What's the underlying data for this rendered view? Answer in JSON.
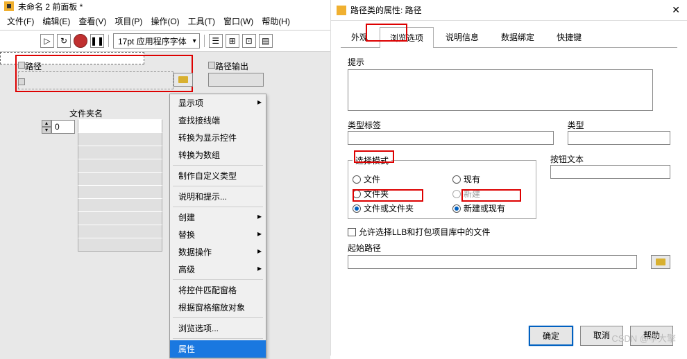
{
  "window": {
    "title": "未命名 2 前面板 *",
    "menus": [
      "文件(F)",
      "编辑(E)",
      "查看(V)",
      "项目(P)",
      "操作(O)",
      "工具(T)",
      "窗口(W)",
      "帮助(H)"
    ],
    "dialog_title": "路径类的属性: 路径"
  },
  "toolbar": {
    "font": "17pt 应用程序字体"
  },
  "canvas": {
    "path_label": "路径",
    "path_out_label": "路径输出",
    "folder_name_label": "文件夹名",
    "array_index": "0"
  },
  "context_menu": {
    "items": [
      "显示项",
      "查找接线端",
      "转换为显示控件",
      "转换为数组"
    ],
    "items2": [
      "制作自定义类型"
    ],
    "items3": [
      "说明和提示..."
    ],
    "items4": [
      "创建",
      "替换",
      "数据操作",
      "高级"
    ],
    "items5": [
      "将控件匹配窗格",
      "根据窗格缩放对象"
    ],
    "items6": [
      "浏览选项..."
    ],
    "items7": [
      "属性"
    ]
  },
  "props": {
    "tabs": [
      "外观",
      "浏览选项",
      "说明信息",
      "数据绑定",
      "快捷键"
    ],
    "hint_label": "提示",
    "type_tag_label": "类型标签",
    "type_label": "类型",
    "mode_label": "选择模式",
    "radio1": "文件",
    "radio2": "现有",
    "radio3": "文件夹",
    "radio4": "新建",
    "radio5": "文件或文件夹",
    "radio6": "新建或现有",
    "btn_text_label": "按钮文本",
    "allow_llb": "允许选择LLB和打包项目库中的文件",
    "start_path_label": "起始路径",
    "ok": "确定",
    "cancel": "取消",
    "help": "帮助"
  },
  "watermark": "CSDN @李大擎"
}
